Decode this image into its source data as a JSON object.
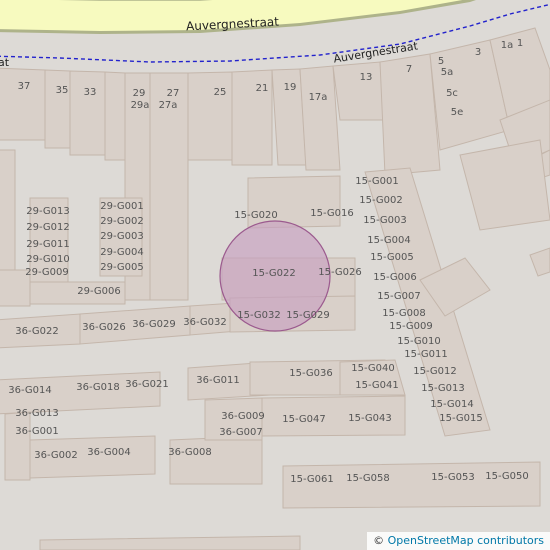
{
  "map": {
    "streets": [
      {
        "id": "auvergnestraat-main",
        "name": "Auvergnestraat"
      },
      {
        "id": "auvergnestraat-footway",
        "name": "Auvergnestraat"
      },
      {
        "id": "footway-left",
        "name": "at"
      }
    ],
    "highlight_marker": {
      "kind": "location-circle",
      "fill": "#c8a0c0",
      "stroke": "#9b5a8e"
    },
    "colors": {
      "background": "#dddad6",
      "building_fill": "#d9d0c9",
      "building_stroke": "#c4b6ab",
      "road_fill": "#f7fabf",
      "road_casing": "#aeb38a",
      "footpath": "#2222cc"
    },
    "house_numbers": [
      "37",
      "35",
      "33",
      "29",
      "29a",
      "27",
      "27a",
      "25",
      "21",
      "19",
      "17a",
      "13",
      "7",
      "5",
      "5a",
      "5c",
      "5e",
      "3",
      "1a",
      "1",
      "15-G001",
      "15-G002",
      "15-G003",
      "15-G004",
      "15-G005",
      "15-G006",
      "15-G007",
      "15-G008",
      "15-G009",
      "15-G010",
      "15-G011",
      "15-G012",
      "15-G013",
      "15-G014",
      "15-G015",
      "15-G016",
      "15-G020",
      "15-G022",
      "15-G026",
      "15-G029",
      "15-G032",
      "15-G036",
      "15-G040",
      "15-G041",
      "15-G043",
      "15-G047",
      "15-G050",
      "15-G053",
      "15-G058",
      "15-G061",
      "29-G001",
      "29-G002",
      "29-G003",
      "29-G004",
      "29-G005",
      "29-G006",
      "29-G009",
      "29-G010",
      "29-G011",
      "29-G012",
      "29-G013",
      "36-G001",
      "36-G002",
      "36-G004",
      "36-G007",
      "36-G008",
      "36-G009",
      "36-G011",
      "36-G013",
      "36-G014",
      "36-G018",
      "36-G021",
      "36-G022",
      "36-G026",
      "36-G029",
      "36-G032"
    ],
    "attribution": {
      "symbol": "©",
      "text": "OpenStreetMap contributors"
    }
  }
}
